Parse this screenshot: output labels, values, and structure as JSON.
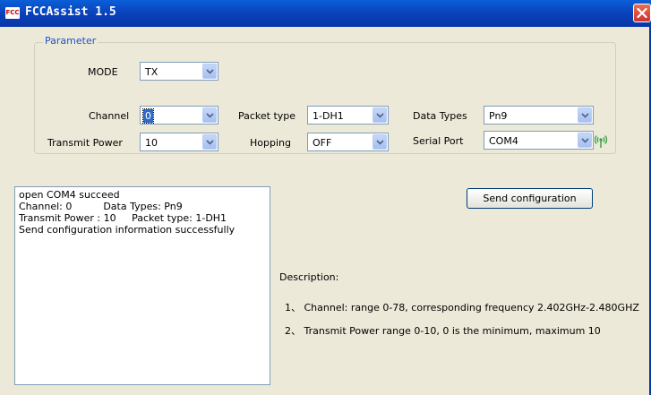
{
  "window": {
    "title": "FCCAssist 1.5",
    "icon_text": "FCC"
  },
  "parameter": {
    "group_label": "Parameter",
    "mode": {
      "label": "MODE",
      "value": "TX"
    },
    "channel": {
      "label": "Channel",
      "value": "0"
    },
    "packet_type": {
      "label": "Packet type",
      "value": "1-DH1"
    },
    "data_types": {
      "label": "Data Types",
      "value": "Pn9"
    },
    "transmit_power": {
      "label": "Transmit Power",
      "value": "10"
    },
    "hopping": {
      "label": "Hopping",
      "value": "OFF"
    },
    "serial_port": {
      "label": "Serial Port",
      "value": "COM4"
    }
  },
  "log": {
    "lines": [
      "open COM4 succeed",
      "Channel: 0          Data Types: Pn9",
      "Transmit Power : 10     Packet type: 1-DH1",
      "Send configuration information successfully"
    ]
  },
  "send_button": {
    "label": "Send configuration"
  },
  "description": {
    "heading": "Description:",
    "items": [
      "1、 Channel: range 0-78, corresponding frequency 2.402GHz-2.480GHZ",
      "2、 Transmit Power  range 0-10, 0 is the minimum, maximum 10"
    ]
  },
  "colors": {
    "titlebar": "#0a4fc8",
    "group_label": "#2052c8",
    "signal_icon": "#2ea043"
  },
  "icons": {
    "app": "fcc-app-icon",
    "close": "close-icon",
    "dropdown": "chevron-down-icon",
    "signal": "wireless-signal-icon"
  }
}
